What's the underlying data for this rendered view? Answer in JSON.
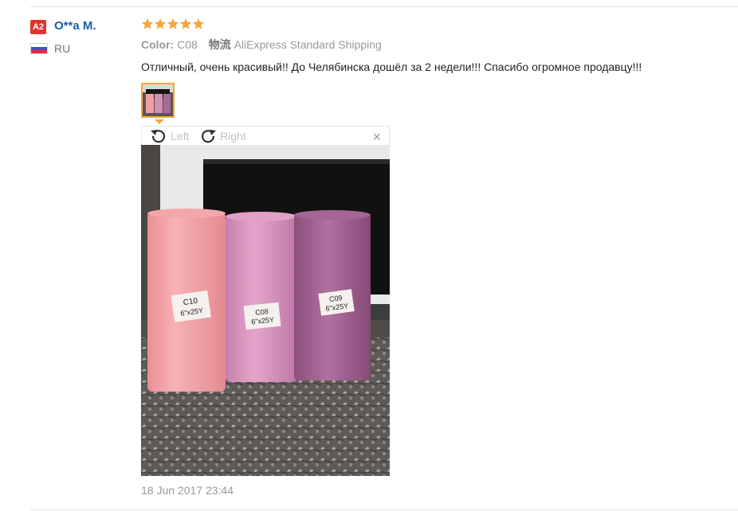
{
  "reviewer": {
    "badge": "A2",
    "name": "O**a M.",
    "country": "RU",
    "flag_colors": [
      "#ffffff",
      "#2f5fb0",
      "#d4333f"
    ]
  },
  "review": {
    "rating": 5,
    "color_label": "Color:",
    "color_value": "C08",
    "shipping_label": "物流",
    "shipping_value": "AliExpress Standard Shipping",
    "text": "Отличный, очень красивый!! До Челябинска дошёл за 2 недели!!! Спасибо огромное продавцу!!!",
    "date": "18 Jun 2017 23:44"
  },
  "viewer": {
    "rotate_left_label": "Left",
    "rotate_right_label": "Right",
    "close_glyph": "×"
  },
  "photo_labels": {
    "roll1_code": "C10",
    "roll1_size": "6\"x25Y",
    "roll2_code": "C08",
    "roll2_size": "6\"x25Y",
    "roll3_code": "C09",
    "roll3_size": "6\"x25Y"
  },
  "colors": {
    "star": "#f7a637",
    "username": "#1d5fa8",
    "badge": "#e0342a",
    "thumb_border": "#f7a637"
  }
}
